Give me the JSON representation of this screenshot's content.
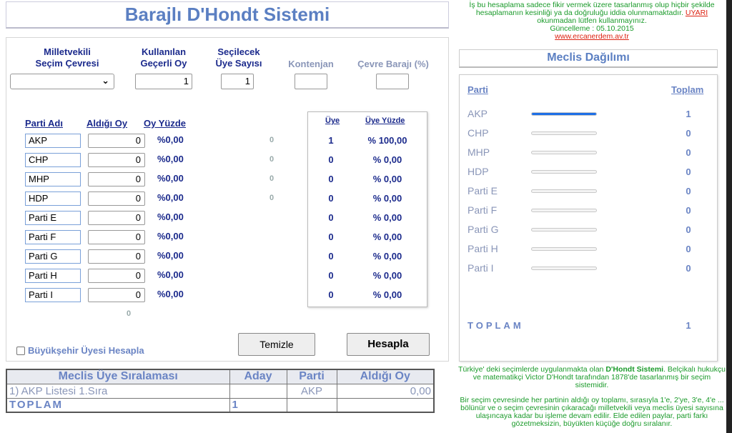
{
  "title": "Barajlı D'Hondt Sistemi",
  "notice": {
    "text": "İş bu hesaplama sadece fikir vermek üzere tasarlanmış olup hiçbir şekilde hesaplamanın kesinliği ya da doğruluğu iddia olunmamaktadır.",
    "warning": "UYARI",
    "text2": "okunmadan lütfen kullanmayınız.",
    "updated": "Güncelleme : 05.10.2015",
    "link": "www.ercanerdem.av.tr"
  },
  "form": {
    "headers": {
      "district_l1": "Milletvekili",
      "district_l2": "Seçim Çevresi",
      "valid_l1": "Kullanılan",
      "valid_l2": "Geçerli Oy",
      "seats_l1": "Seçilecek",
      "seats_l2": "Üye Sayısı",
      "quota": "Kontenjan",
      "threshold": "Çevre Barajı (%)"
    },
    "values": {
      "district": "",
      "valid_votes": "1",
      "seats": "1",
      "quota": "",
      "threshold": ""
    },
    "party_headers": {
      "name": "Parti Adı",
      "votes": "Aldığı Oy",
      "pct": "Oy Yüzde",
      "seat": "Üye",
      "seat_pct": "Üye Yüzde"
    },
    "parties": [
      {
        "name": "AKP",
        "votes": "0",
        "pct": "%0,00",
        "extra": "0",
        "seats": "1",
        "seat_pct": "% 100,00"
      },
      {
        "name": "CHP",
        "votes": "0",
        "pct": "%0,00",
        "extra": "0",
        "seats": "0",
        "seat_pct": "% 0,00"
      },
      {
        "name": "MHP",
        "votes": "0",
        "pct": "%0,00",
        "extra": "0",
        "seats": "0",
        "seat_pct": "% 0,00"
      },
      {
        "name": "HDP",
        "votes": "0",
        "pct": "%0,00",
        "extra": "0",
        "seats": "0",
        "seat_pct": "% 0,00"
      },
      {
        "name": "Parti E",
        "votes": "0",
        "pct": "%0,00",
        "extra": "",
        "seats": "0",
        "seat_pct": "% 0,00"
      },
      {
        "name": "Parti F",
        "votes": "0",
        "pct": "%0,00",
        "extra": "",
        "seats": "0",
        "seat_pct": "% 0,00"
      },
      {
        "name": "Parti G",
        "votes": "0",
        "pct": "%0,00",
        "extra": "",
        "seats": "0",
        "seat_pct": "% 0,00"
      },
      {
        "name": "Parti H",
        "votes": "0",
        "pct": "%0,00",
        "extra": "",
        "seats": "0",
        "seat_pct": "% 0,00"
      },
      {
        "name": "Parti I",
        "votes": "0",
        "pct": "%0,00",
        "extra": "",
        "seats": "0",
        "seat_pct": "% 0,00"
      }
    ],
    "total_votes": "0",
    "metro_checkbox_label": "Büyükşehir Üyesi Hesapla",
    "clear_button": "Temizle",
    "calc_button": "Hesapla"
  },
  "meclis": {
    "title": "Meclis Dağılımı",
    "col_party": "Parti",
    "col_total": "Toplam",
    "rows": [
      {
        "name": "AKP",
        "total": "1",
        "share": 1.0
      },
      {
        "name": "CHP",
        "total": "0",
        "share": 0
      },
      {
        "name": "MHP",
        "total": "0",
        "share": 0
      },
      {
        "name": "HDP",
        "total": "0",
        "share": 0
      },
      {
        "name": "Parti E",
        "total": "0",
        "share": 0
      },
      {
        "name": "Parti F",
        "total": "0",
        "share": 0
      },
      {
        "name": "Parti G",
        "total": "0",
        "share": 0
      },
      {
        "name": "Parti H",
        "total": "0",
        "share": 0
      },
      {
        "name": "Parti I",
        "total": "0",
        "share": 0
      }
    ],
    "total_label": "TOPLAM",
    "total_value": "1"
  },
  "ranking": {
    "headers": {
      "title": "Meclis Üye Sıralaması",
      "candidate": "Aday",
      "party": "Parti",
      "votes": "Aldığı Oy"
    },
    "rows": [
      {
        "title": "1) AKP Listesi 1.Sıra",
        "candidate": "",
        "party": "AKP",
        "votes": "0,00"
      }
    ],
    "total_label": "TOPLAM",
    "total_value": "1"
  },
  "footer": {
    "p1_a": "Türkiye' deki seçimlerde uygulanmakta olan",
    "p1_b": "D'Hondt Sistemi",
    "p1_c": ". Belçikalı hukukçu ve matematikçi Victor D'Hondt tarafından 1878'de tasarlanmış bir seçim sistemidir.",
    "p2": "Bir seçim çevresinde her partinin aldığı oy toplamı, sırasıyla 1'e, 2'ye, 3'e, 4'e ... bölünür ve o seçim çevresinin çıkaracağı milletvekili veya meclis üyesi sayısına ulaşıncaya kadar bu işleme devam edilir. Elde edilen paylar, parti farkı gözetmeksizin, büyükten küçüğe doğru sıralanır."
  }
}
